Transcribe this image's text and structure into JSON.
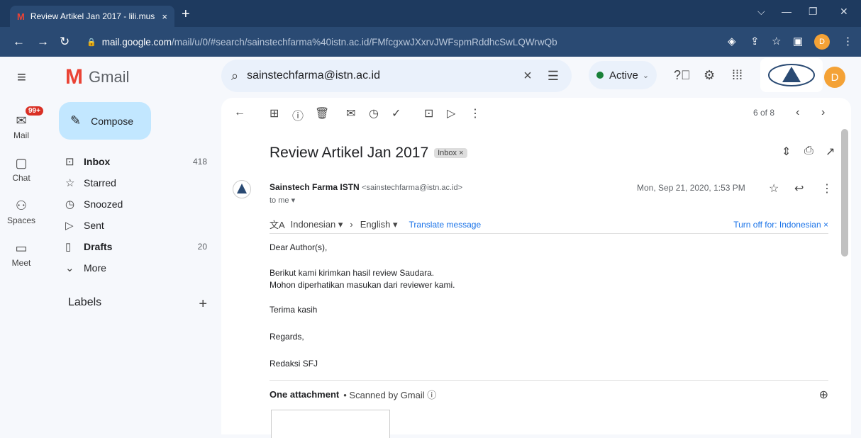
{
  "browser": {
    "tab_title": "Review Artikel Jan 2017 - lili.mus",
    "tab_logo": "M",
    "tab_close": "×",
    "new_tab": "+",
    "url_host": "mail.google.com",
    "url_path": "/mail/u/0/#search/sainstechfarma%40istn.ac.id/FMfcgxwJXxrvJWFspmRddhcSwLQWrwQb",
    "profile_initial": "D"
  },
  "gmail": {
    "brand": "Gmail",
    "search_query": "sainstechfarma@istn.ac.id",
    "status": "Active",
    "account_initial": "D"
  },
  "rail": {
    "mail": "Mail",
    "mail_badge": "99+",
    "chat": "Chat",
    "spaces": "Spaces",
    "meet": "Meet"
  },
  "nav": {
    "compose": "Compose",
    "items": [
      {
        "label": "Inbox",
        "count": "418"
      },
      {
        "label": "Starred",
        "count": ""
      },
      {
        "label": "Snoozed",
        "count": ""
      },
      {
        "label": "Sent",
        "count": ""
      },
      {
        "label": "Drafts",
        "count": "20"
      },
      {
        "label": "More",
        "count": ""
      }
    ],
    "labels_heading": "Labels"
  },
  "message": {
    "pager": "6 of 8",
    "subject": "Review Artikel Jan 2017",
    "chip": "Inbox ×",
    "sender_name": "Sainstech Farma ISTN",
    "sender_email": "<sainstechfarma@istn.ac.id>",
    "to": "to me ▾",
    "date": "Mon, Sep 21, 2020, 1:53 PM",
    "translate": {
      "from_lang": "Indonesian ▾",
      "to_lang": "English ▾",
      "action": "Translate message",
      "turn_off": "Turn off for: Indonesian ×"
    },
    "body": [
      "Dear Author(s),",
      "Berikut  kami kirimkan hasil review Saudara.",
      "Mohon diperhatikan masukan dari reviewer kami.",
      "Terima kasih",
      "Regards,",
      "Redaksi SFJ"
    ],
    "attachment_title": "One attachment",
    "attachment_note": "• Scanned by Gmail ⓘ"
  }
}
